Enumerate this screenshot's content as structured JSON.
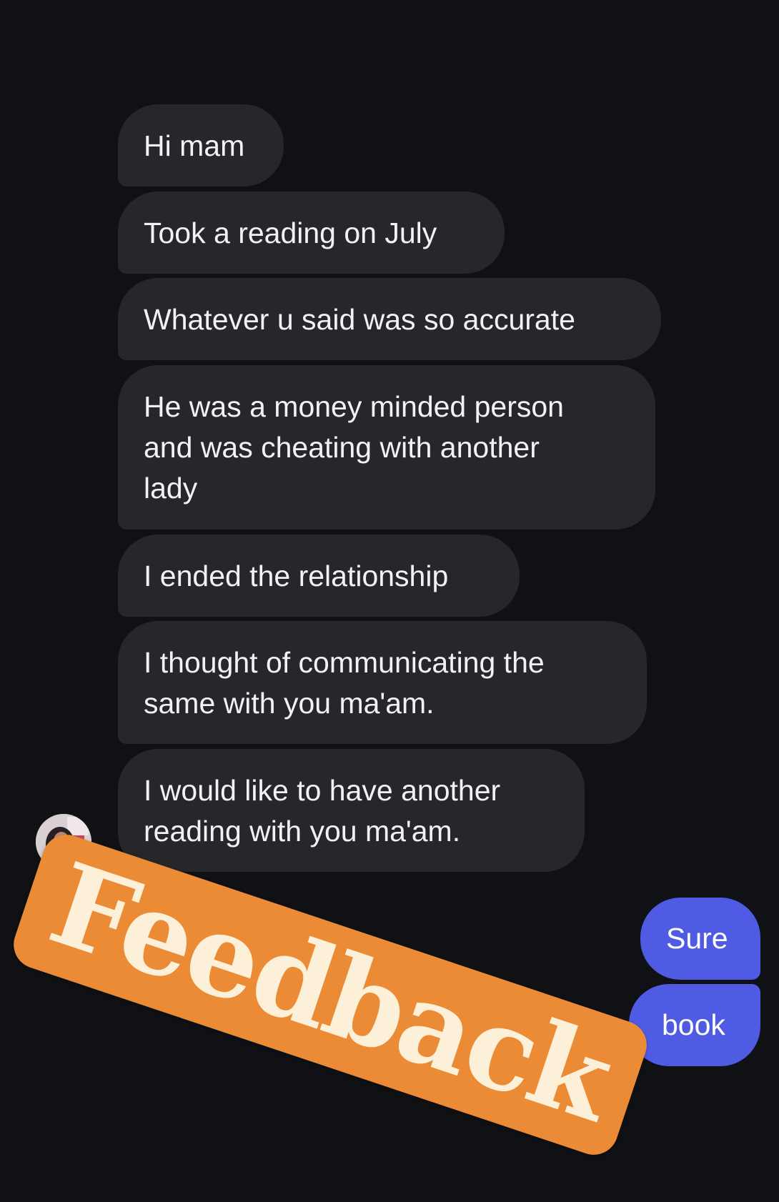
{
  "thread": {
    "incoming": [
      {
        "text": "Hi mam"
      },
      {
        "text": "Took a reading on July"
      },
      {
        "text": "Whatever u said was so accurate"
      },
      {
        "text": "He was a money minded person\nand was cheating with another\nlady"
      },
      {
        "text": "I ended the relationship"
      },
      {
        "text": "I thought of communicating the\nsame with you ma'am."
      },
      {
        "text": "I would like to have another\nreading with you ma'am."
      }
    ],
    "outgoing": [
      {
        "text": "Sure"
      },
      {
        "text": "book"
      }
    ]
  },
  "sticker": {
    "text": "Feedback"
  },
  "colors": {
    "background": "#101115",
    "incoming_bubble": "#26272b",
    "outgoing_bubble": "#4f5be3",
    "sticker": "#ec8b36",
    "sticker_text": "#fdf0d9"
  },
  "icons": {
    "avatar": "contact-avatar"
  }
}
